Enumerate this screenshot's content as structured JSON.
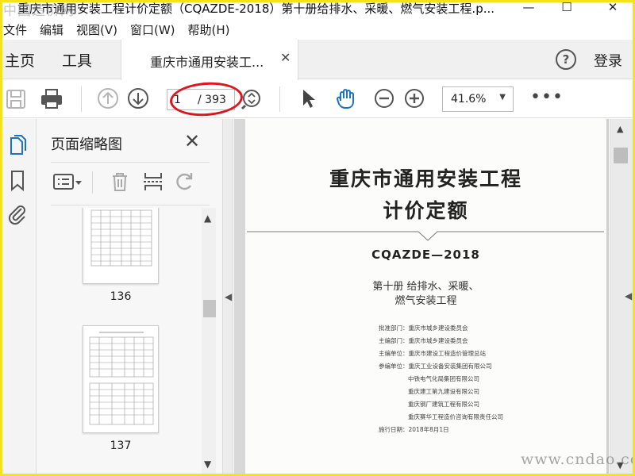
{
  "window": {
    "title": "重庆市通用安装工程计价定额（CQAZDE-2018）第十册给排水、采暖、燃气安装工程.p...",
    "minimize_glyph": "—",
    "maximize_glyph": "☐",
    "close_glyph": "✕"
  },
  "watermark_top": "中国造价网",
  "menu": [
    "文件",
    "编辑",
    "视图(V)",
    "窗口(W)",
    "帮助(H)"
  ],
  "tabs": {
    "home": "主页",
    "tools": "工具",
    "document": "重庆市通用安装工...",
    "close_glyph": "✕",
    "help_glyph": "?",
    "login": "登录"
  },
  "toolbar": {
    "page_current": "1",
    "page_total": "/ 393",
    "zoom": "41.6%",
    "zoom_caret": "▼",
    "more": "•••"
  },
  "thumbnail_panel": {
    "title": "页面缩略图",
    "close_glyph": "✕",
    "pages": [
      {
        "label": "136"
      },
      {
        "label": "137"
      }
    ],
    "scroll_up": "▲",
    "scroll_down": "▼"
  },
  "document": {
    "title_line1": "重庆市通用安装工程",
    "title_line2": "计价定额",
    "code": "CQAZDE—2018",
    "subtitle_line1": "第十册  给排水、采暖、",
    "subtitle_line2": "燃气安装工程",
    "info": [
      "批准部门：重庆市城乡建设委员会",
      "主编部门：重庆市城乡建设委员会",
      "主编单位：重庆市建设工程造价管理总站",
      "参编单位：重庆工业设备安装集团有限公司",
      "中铁电气化局集团有限公司",
      "重庆建工第九建设有限公司",
      "重庆钢厂建筑工程有限公司",
      "重庆赛华工程造价咨询有限责任公司",
      "施行日期：2018年8月1日"
    ]
  },
  "scroll": {
    "up": "▲",
    "down": "▼",
    "left": "◀"
  },
  "watermark_bottom": "www.cndao.com",
  "colors": {
    "frame": "#f5e21a",
    "annotation": "#e0141e",
    "hand_tool": "#1a73c8"
  },
  "icons": {
    "save": "save-icon",
    "print": "print-icon",
    "prev_page": "arrow-up-circle-icon",
    "next_page": "arrow-down-circle-icon",
    "page_nav": "page-nav-icon",
    "select": "pointer-icon",
    "hand": "hand-icon",
    "zoom_out": "zoom-out-icon",
    "zoom_in": "zoom-in-icon",
    "thumbnails": "pages-icon",
    "bookmarks": "bookmark-icon",
    "attachments": "paperclip-icon",
    "options": "options-icon",
    "delete": "trash-icon",
    "insert": "insert-page-icon",
    "rotate": "rotate-icon"
  }
}
